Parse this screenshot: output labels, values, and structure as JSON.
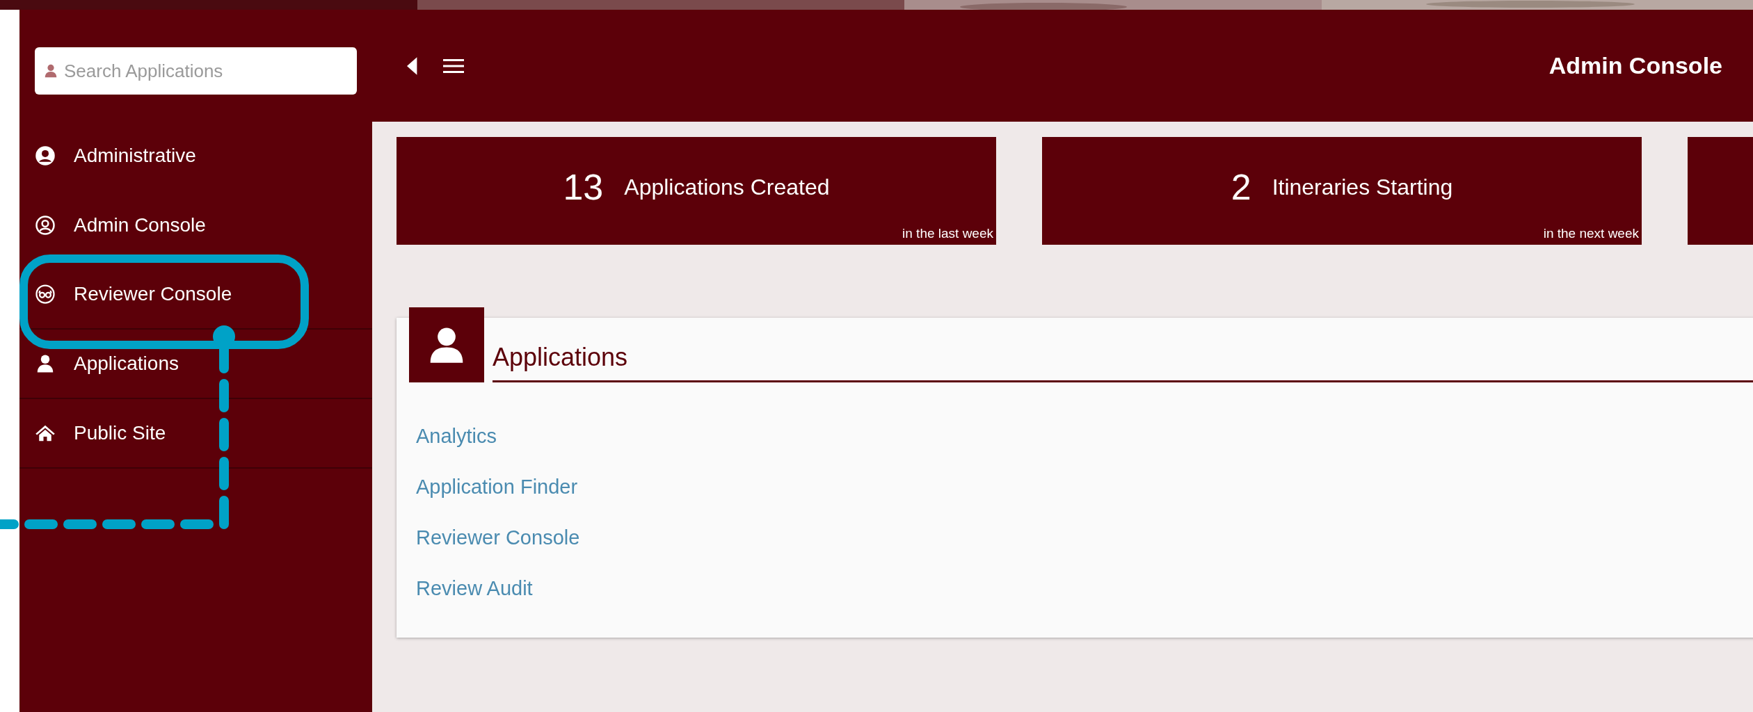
{
  "sidebar": {
    "search": {
      "placeholder": "Search Applications"
    },
    "items": [
      {
        "label": "Administrative"
      },
      {
        "label": "Admin Console"
      },
      {
        "label": "Reviewer Console"
      },
      {
        "label": "Applications"
      },
      {
        "label": "Public Site"
      }
    ]
  },
  "topbar": {
    "title": "Admin Console"
  },
  "stats": [
    {
      "value": "13",
      "label": "Applications Created",
      "note": "in the last week"
    },
    {
      "value": "2",
      "label": "Itineraries Starting",
      "note": "in the next week"
    }
  ],
  "panel": {
    "title": "Applications",
    "links": [
      "Analytics",
      "Application Finder",
      "Reviewer Console",
      "Review Audit"
    ]
  }
}
